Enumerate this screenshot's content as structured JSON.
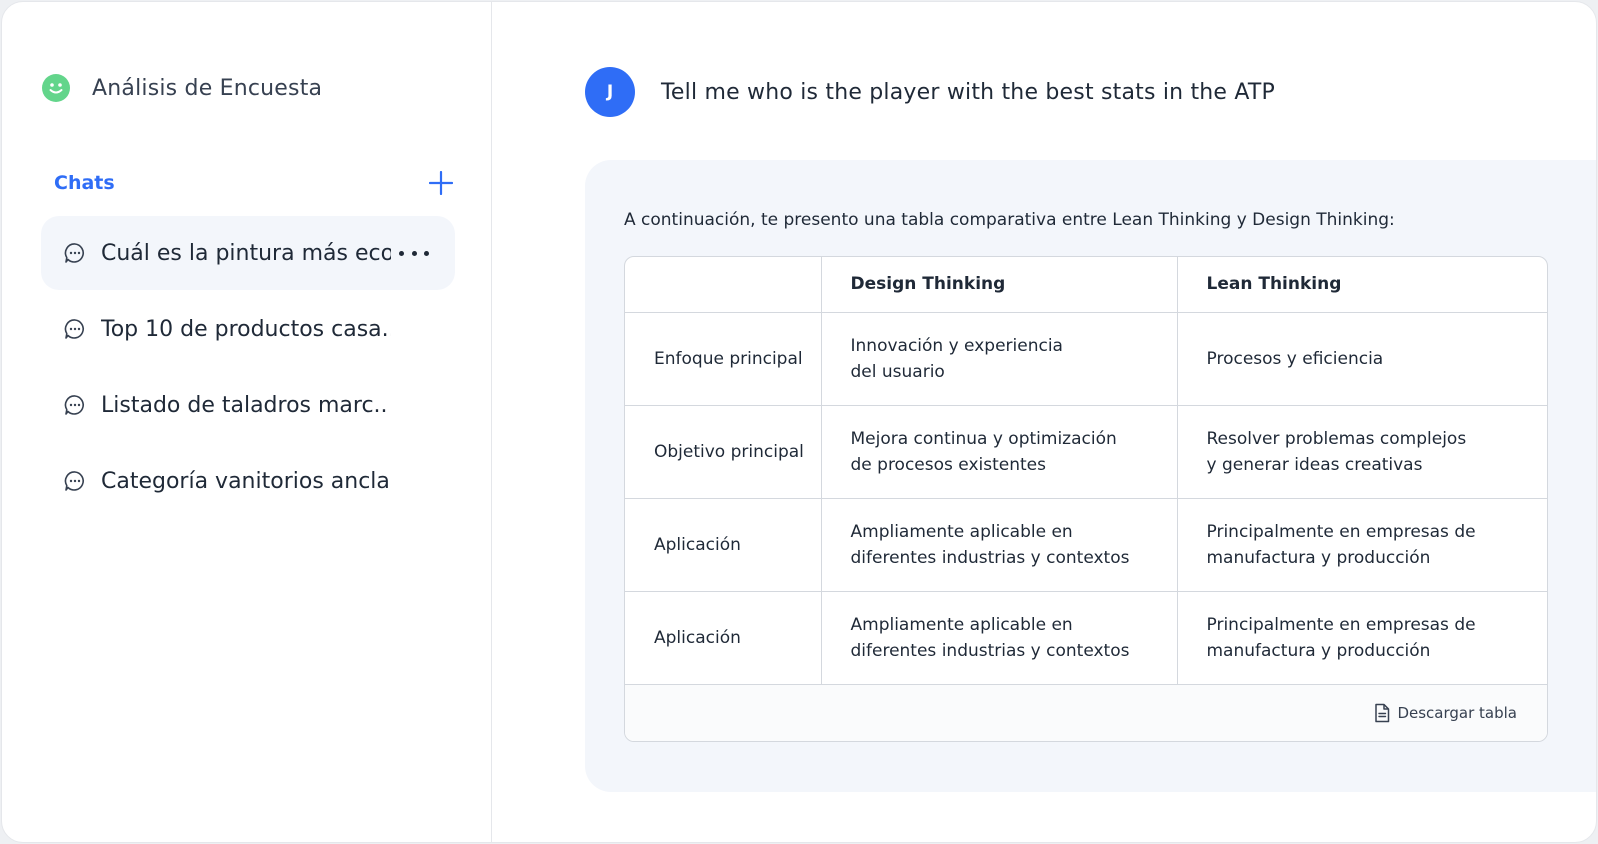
{
  "app": {
    "title": "Análisis de Encuesta",
    "logo": "smiley-icon",
    "logo_color": "#63d58b"
  },
  "sidebar": {
    "section_label": "Chats",
    "add_icon": "plus-icon",
    "chats": [
      {
        "label": "Cuál es la pintura más eco",
        "active": true
      },
      {
        "label": "Top 10 de productos casa..",
        "active": false
      },
      {
        "label": "Listado de taladros marc..",
        "active": false
      },
      {
        "label": "Categoría vanitorios ancla.",
        "active": false
      }
    ]
  },
  "conversation": {
    "user": {
      "initial": "J",
      "avatar_color": "#2f6df6"
    },
    "user_message": "Tell me who is the player with the best stats in the ATP",
    "response_intro": "A continuación, te presento una tabla comparativa entre Lean Thinking y Design Thinking:",
    "table": {
      "headers": [
        "",
        "Design Thinking",
        "Lean Thinking"
      ],
      "rows": [
        [
          "Enfoque principal",
          "Innovación y experiencia\ndel usuario",
          "Procesos y eficiencia"
        ],
        [
          "Objetivo principal",
          "Mejora continua y optimización\nde procesos existentes",
          "Resolver problemas complejos\ny generar ideas creativas"
        ],
        [
          "Aplicación",
          "Ampliamente aplicable en\ndiferentes industrias y contextos",
          "Principalmente en empresas de\nmanufactura y producción"
        ],
        [
          "Aplicación",
          "Ampliamente aplicable en\ndiferentes industrias y contextos",
          "Principalmente en empresas de\nmanufactura y producción"
        ]
      ],
      "download_label": "Descargar tabla",
      "download_icon": "document-icon"
    }
  },
  "colors": {
    "accent": "#2f6df6",
    "panel": "#f3f6fb",
    "border": "#d4d8de"
  }
}
